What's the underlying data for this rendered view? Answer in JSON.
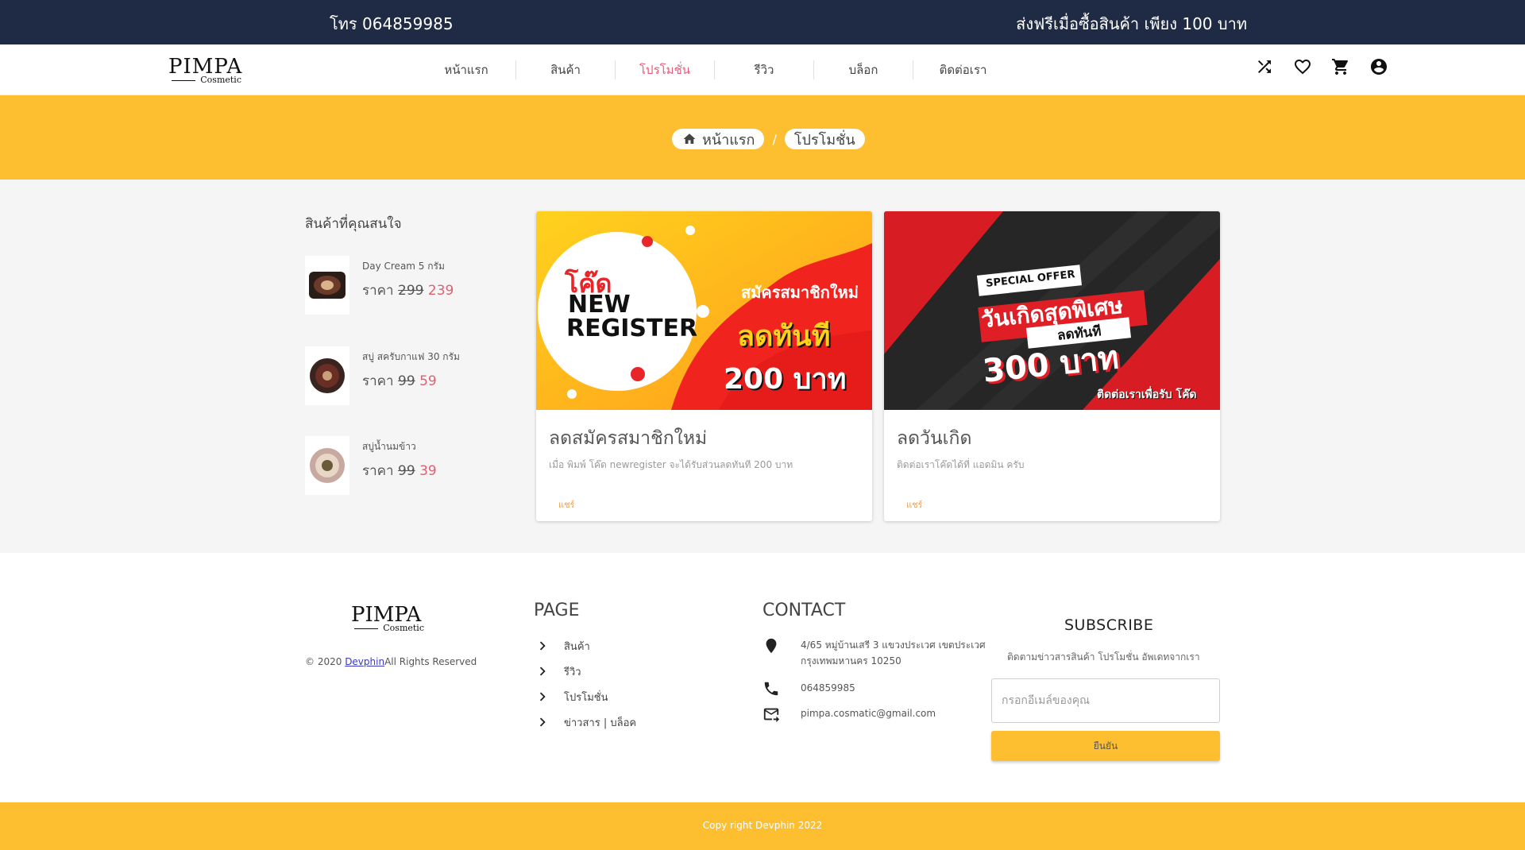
{
  "topbar": {
    "phone": "โทร 064859985",
    "shipping": "ส่งฟรีเมื่อซื้อสินค้า เพียง 100 บาท"
  },
  "brand": {
    "name": "PIMPA",
    "sub": "Cosmetic"
  },
  "menu": {
    "items": [
      {
        "label": "หน้าแรก"
      },
      {
        "label": "สินค้า"
      },
      {
        "label": "โปรโมชั่น"
      },
      {
        "label": "รีวิว"
      },
      {
        "label": "บล็อก"
      },
      {
        "label": "ติดต่อเรา"
      }
    ],
    "active_index": 2
  },
  "nav_icons": [
    "shuffle-icon",
    "heart-icon",
    "cart-icon",
    "account-icon"
  ],
  "breadcrumb": {
    "home": "หน้าแรก",
    "separator": "/",
    "current": "โปรโมชั่น"
  },
  "sidebar": {
    "title": "สินค้าที่คุณสนใจ",
    "products": [
      {
        "name": "Day Cream 5 กรัม",
        "price_label": "ราคา",
        "old_price": "299",
        "new_price": "239"
      },
      {
        "name": "สบู่ สครับกาแฟ 30 กรัม",
        "price_label": "ราคา",
        "old_price": "99",
        "new_price": "59"
      },
      {
        "name": "สบู่น้ำนมข้าว",
        "price_label": "ราคา",
        "old_price": "99",
        "new_price": "39"
      }
    ]
  },
  "promos": [
    {
      "banner": {
        "code_label": "โค๊ด",
        "line1": "NEW",
        "line2": "REGISTER",
        "tagline": "สมัครสมาชิกใหม่",
        "discount": "ลดทันที",
        "amount": "200 บาท"
      },
      "title": "ลดสมัครสมาชิกใหม่",
      "description": "เมื่อ พิมพ์ โค๊ด newregister จะได้รับส่วนลดทันที 200 บาท",
      "share": "แชร์"
    },
    {
      "banner": {
        "special": "SPECIAL OFFER",
        "headline": "วันเกิดสุดพิเศษ",
        "discount": "ลดทันที",
        "amount": "300 บาท",
        "contact": "ติดต่อเราเพื่อรับ โค๊ด"
      },
      "title": "ลดวันเกิด",
      "description": "ติดต่อเราโค๊ดได้ที่ แอดมิน ครับ",
      "share": "แชร์"
    }
  ],
  "footer": {
    "copyright_prefix": "© 2020",
    "copyright_link": "Devphin",
    "copyright_suffix": "All Rights Reserved",
    "page_heading": "PAGE",
    "page_links": [
      "สินค้า",
      "รีวิว",
      "โปรโมชั่น",
      "ข่าวสาร | บล็อค"
    ],
    "contact_heading": "CONTACT",
    "address": "4/65 หมู่บ้านเสรี 3 แขวงประเวศ เขตประเวศ กรุงเทพมหานคร 10250",
    "phone": "064859985",
    "email": "pimpa.cosmatic@gmail.com",
    "subscribe_heading": "SUBSCRIBE",
    "subscribe_desc": "ติดตามข่าวสารสินค้า โปรโมชั่น อัพเดทจากเรา",
    "email_placeholder": "กรอกอีเมล์ของคุณ",
    "submit_label": "ยืนยัน",
    "bottom_text": "Copy right Devphin 2022"
  },
  "colors": {
    "topbar": "#1f2a44",
    "accent": "#fdbf30",
    "active_menu": "#e65a7a",
    "sale_price": "#e06070"
  }
}
